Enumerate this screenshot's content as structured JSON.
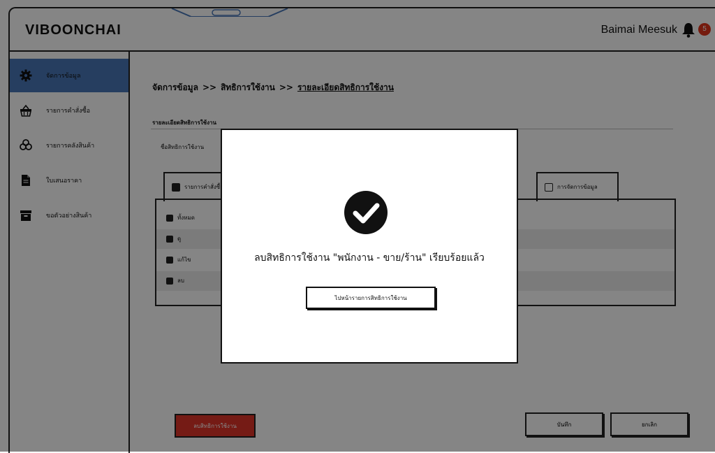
{
  "header": {
    "brand": "VIBOONCHAI",
    "user_name": "Baimai Meesuk",
    "notification_count": "5"
  },
  "sidebar": {
    "items": [
      {
        "label": "จัดการข้อมูล",
        "icon": "gear-icon",
        "active": true
      },
      {
        "label": "รายการคำสั่งซื้อ",
        "icon": "basket-icon"
      },
      {
        "label": "รายการคลังสินค้า",
        "icon": "boxes-icon"
      },
      {
        "label": "ใบเสนอราคา",
        "icon": "document-icon"
      },
      {
        "label": "ขอตัวอย่างสินค้า",
        "icon": "archive-icon"
      }
    ]
  },
  "breadcrumb": {
    "items": [
      "จัดการข้อมูล",
      "สิทธิการใช้งาน"
    ],
    "separator": ">>",
    "current": "รายละเอียดสิทธิการใช้งาน"
  },
  "section": {
    "title": "รายละเอียดสิทธิการใช้งาน",
    "name_label": "ชื่อสิทธิการใช้งาน"
  },
  "tabs": [
    {
      "label": "รายการคำสั่งซื้อ",
      "checked": true
    },
    {
      "label": "การจัดการข้อมูล",
      "checked": false
    }
  ],
  "permissions": [
    {
      "label": "ทั้งหมด",
      "checked": true
    },
    {
      "label": "ดู",
      "checked": true
    },
    {
      "label": "แก้ไข",
      "checked": true
    },
    {
      "label": "ลบ",
      "checked": true
    }
  ],
  "actions": {
    "delete": "ลบสิทธิการใช้งาน",
    "save": "บันทึก",
    "cancel": "ยกเลิก"
  },
  "modal": {
    "message": "ลบสิทธิการใช้งาน \"พนักงาน - ขาย/ร้าน\" เรียบร้อยแล้ว",
    "button": "ไปหน้ารายการสิทธิการใช้งาน",
    "icon": "check-circle-icon"
  },
  "colors": {
    "accent": "#4a78b8",
    "danger": "#e0352a",
    "badge": "#e0341c"
  }
}
